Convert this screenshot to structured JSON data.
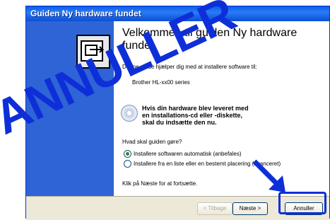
{
  "window": {
    "title": "Guiden Ny hardware fundet"
  },
  "content": {
    "heading": "Velkommen til guiden Ny hardware fundet.",
    "intro": "Denne guide hjælper dig med at installere software til:",
    "device": "Brother HL-xx00 series",
    "warning_line1": "Hvis din hardware blev leveret med",
    "warning_line2": "en installations-cd eller -diskette,",
    "warning_line3": "skal du indsætte den nu.",
    "question": "Hvad skal guiden gøre?",
    "option1": "Installere softwaren automatisk (anbefales)",
    "option2": "Installere fra en liste eller en bestemt placering (avanceret)",
    "next_hint": "Klik på Næste for at fortsætte."
  },
  "buttons": {
    "back": "< Tilbage",
    "next": "Næste >",
    "cancel": "Annuller"
  },
  "overlay": {
    "text": "ANNULLER"
  },
  "colors": {
    "overlay": "#0e2fd8",
    "titlebar": "#0a5fe8"
  }
}
